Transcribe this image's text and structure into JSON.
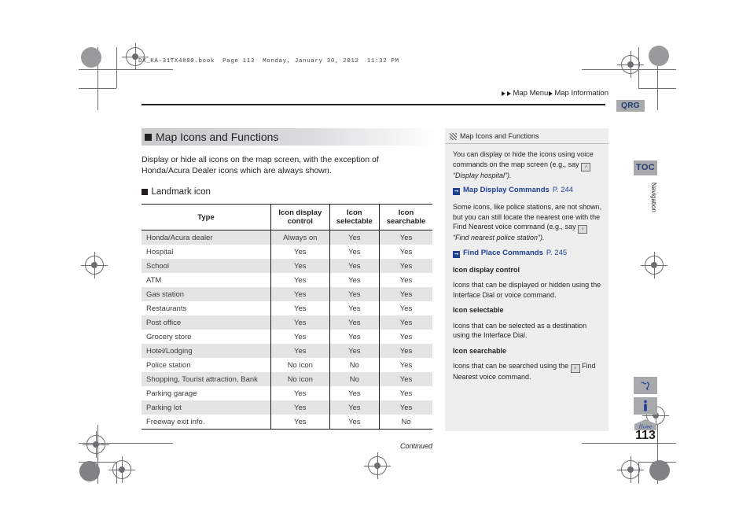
{
  "print_header": "DX_KA-31TX4800.book  Page 113  Monday, January 30, 2012  11:32 PM",
  "breadcrumb": {
    "items": [
      "Map Menu",
      "Map Information"
    ]
  },
  "edge_tabs": {
    "qrg": "QRG",
    "toc": "TOC",
    "vertical_label": "Navigation"
  },
  "page_number": "113",
  "main": {
    "section_title": "Map Icons and Functions",
    "intro": "Display or hide all icons on the map screen, with the exception of Honda/Acura Dealer icons which are always shown.",
    "sub_head": "Landmark icon",
    "continued": "Continued",
    "table": {
      "headers": [
        "Type",
        "Icon display control",
        "Icon selectable",
        "Icon searchable"
      ],
      "rows": [
        [
          "Honda/Acura dealer",
          "Always on",
          "Yes",
          "Yes"
        ],
        [
          "Hospital",
          "Yes",
          "Yes",
          "Yes"
        ],
        [
          "School",
          "Yes",
          "Yes",
          "Yes"
        ],
        [
          "ATM",
          "Yes",
          "Yes",
          "Yes"
        ],
        [
          "Gas station",
          "Yes",
          "Yes",
          "Yes"
        ],
        [
          "Restaurants",
          "Yes",
          "Yes",
          "Yes"
        ],
        [
          "Post office",
          "Yes",
          "Yes",
          "Yes"
        ],
        [
          "Grocery store",
          "Yes",
          "Yes",
          "Yes"
        ],
        [
          "Hotel/Lodging",
          "Yes",
          "Yes",
          "Yes"
        ],
        [
          "Police station",
          "No icon",
          "No",
          "Yes"
        ],
        [
          "Shopping, Tourist attraction, Bank",
          "No icon",
          "No",
          "Yes"
        ],
        [
          "Parking garage",
          "Yes",
          "Yes",
          "Yes"
        ],
        [
          "Parking lot",
          "Yes",
          "Yes",
          "Yes"
        ],
        [
          "Freeway exit info.",
          "Yes",
          "Yes",
          "No"
        ]
      ]
    }
  },
  "info_panel": {
    "title": "Map Icons and Functions",
    "para1_a": "You can display or hide the icons using voice commands on the map screen (e.g., say ",
    "para1_b": "“Display hospital”).",
    "link1_text": "Map Display Commands",
    "link1_page": "P. 244",
    "para2_a": "Some icons, like police stations, are not shown, but you can still locate the nearest one with the Find Nearest voice command (e.g., say ",
    "para2_b": "“Find nearest police station”).",
    "link2_text": "Find Place Commands",
    "link2_page": "P. 245",
    "head1": "Icon display control",
    "body1": "Icons that can be displayed or hidden using the Interface Dial or voice command.",
    "head2": "Icon selectable",
    "body2": "Icons that can be selected as a destination using the Interface Dial.",
    "head3": "Icon searchable",
    "body3_a": "Icons that can be searched using the ",
    "body3_b": " Find Nearest voice command."
  },
  "icons": {
    "voice": "♪",
    "info": "i",
    "home": "Home"
  }
}
